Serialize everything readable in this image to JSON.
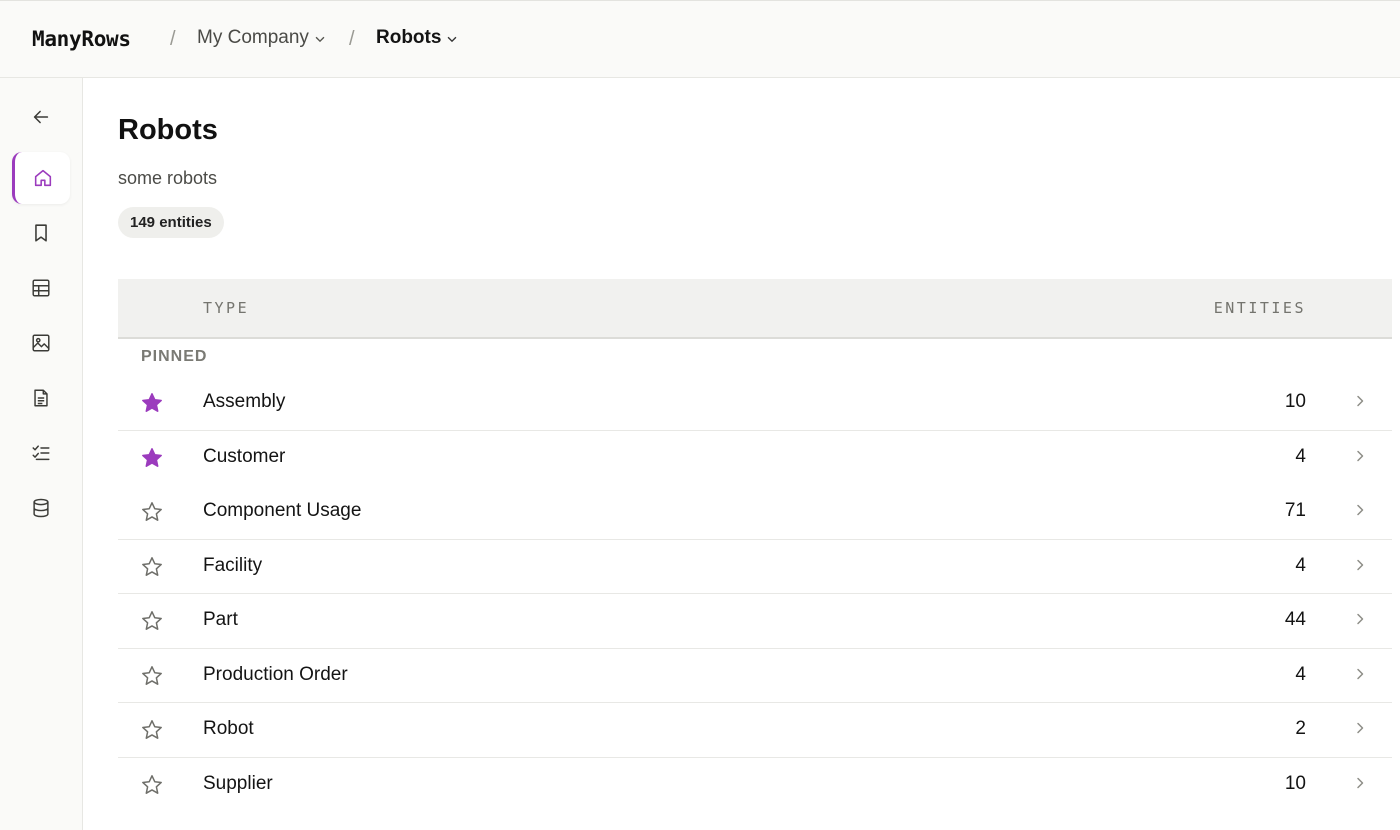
{
  "app": {
    "logo": "ManyRows"
  },
  "breadcrumb": {
    "separator": "/",
    "items": [
      {
        "label": "My Company",
        "current": false
      },
      {
        "label": "Robots",
        "current": true
      }
    ]
  },
  "sidebar": {
    "items": [
      {
        "name": "back",
        "icon": "arrow-left-icon",
        "active": false
      },
      {
        "name": "home",
        "icon": "home-icon",
        "active": true
      },
      {
        "name": "bookmarks",
        "icon": "bookmark-icon",
        "active": false
      },
      {
        "name": "tables",
        "icon": "table-icon",
        "active": false
      },
      {
        "name": "images",
        "icon": "image-icon",
        "active": false
      },
      {
        "name": "documents",
        "icon": "document-icon",
        "active": false
      },
      {
        "name": "tasks",
        "icon": "checklist-icon",
        "active": false
      },
      {
        "name": "database",
        "icon": "database-icon",
        "active": false
      }
    ]
  },
  "page": {
    "title": "Robots",
    "description": "some robots",
    "entity_count_badge": "149 entities"
  },
  "table": {
    "columns": {
      "type": "TYPE",
      "entities": "ENTITIES"
    },
    "pinned_label": "PINNED",
    "pinned_rows": [
      {
        "name": "Assembly",
        "count": "10"
      },
      {
        "name": "Customer",
        "count": "4"
      }
    ],
    "rows": [
      {
        "name": "Component Usage",
        "count": "71"
      },
      {
        "name": "Facility",
        "count": "4"
      },
      {
        "name": "Part",
        "count": "44"
      },
      {
        "name": "Production Order",
        "count": "4"
      },
      {
        "name": "Robot",
        "count": "2"
      },
      {
        "name": "Supplier",
        "count": "10"
      }
    ]
  },
  "colors": {
    "accent": "#9b3bbd",
    "star_pinned": "#9b3bbd",
    "star_unpinned": "#6f6f6a"
  }
}
